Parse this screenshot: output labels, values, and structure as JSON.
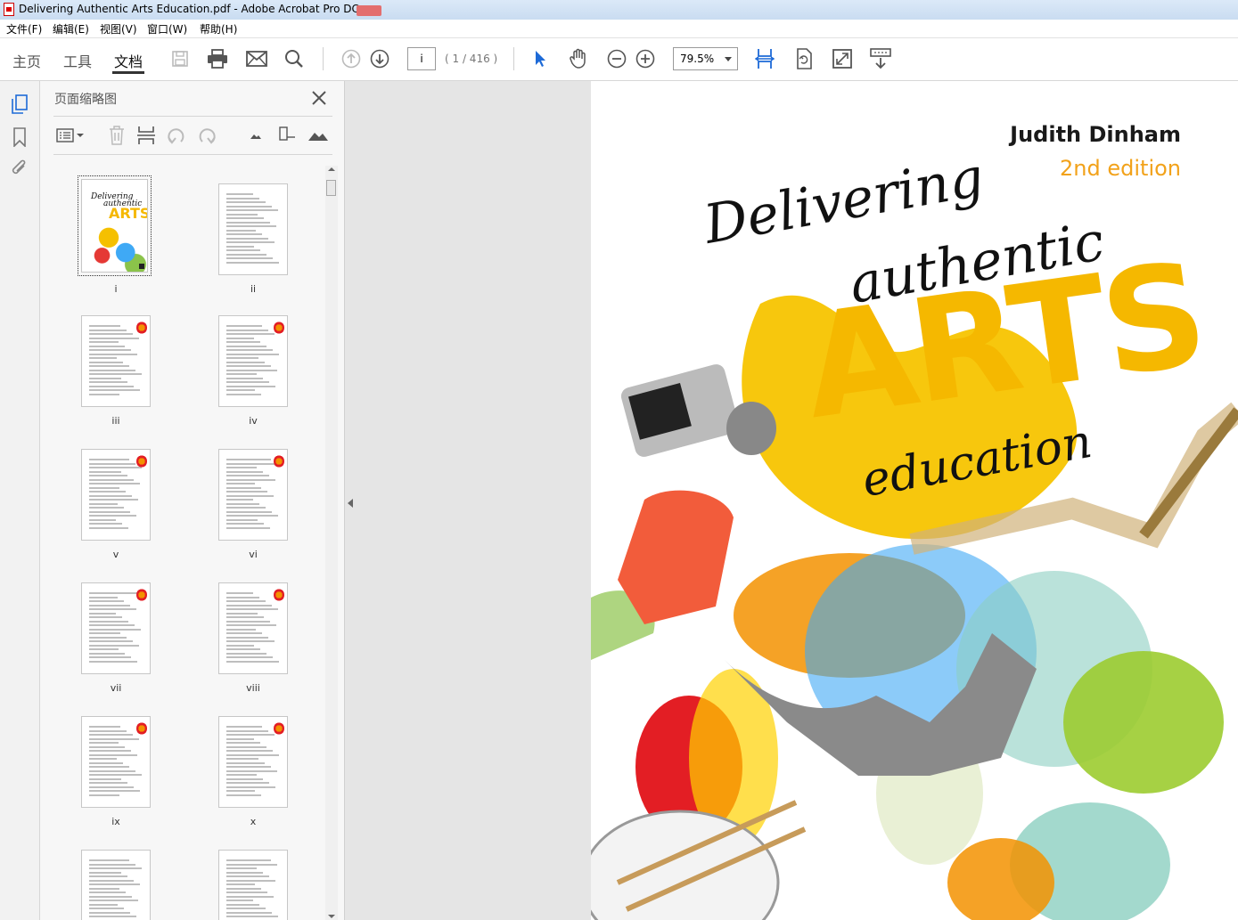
{
  "window": {
    "title": "Delivering Authentic Arts Education.pdf - Adobe Acrobat Pro DC"
  },
  "menu": [
    "文件(F)",
    "编辑(E)",
    "视图(V)",
    "窗口(W)",
    "帮助(H)"
  ],
  "toolbar": {
    "tabs": [
      "主页",
      "工具",
      "文档"
    ],
    "active_tab": "文档",
    "page_input": "i",
    "page_count": "( 1 / 416 )",
    "zoom": "79.5%"
  },
  "sidebar": {
    "panel_title": "页面缩略图",
    "thumbnails": [
      "i",
      "ii",
      "iii",
      "iv",
      "v",
      "vi",
      "vii",
      "viii",
      "ix",
      "x",
      "",
      ""
    ],
    "selected": "i"
  },
  "cover": {
    "author": "Judith Dinham",
    "edition": "2nd edition",
    "title_line1": "Delivering",
    "title_line2": "authentic",
    "title_big": "ARTS",
    "title_line3": "education",
    "accent": "#f5b800",
    "edition_color": "#f2a21a"
  },
  "icons": [
    "save-icon",
    "print-icon",
    "email-icon",
    "search-icon",
    "page-up-icon",
    "page-down-icon",
    "select-cursor-icon",
    "hand-icon",
    "zoom-out-icon",
    "zoom-in-icon",
    "fit-width-icon",
    "rotate-page-icon",
    "full-screen-icon",
    "scroll-mode-icon",
    "pages-panel-icon",
    "bookmark-icon",
    "attachment-icon",
    "close-icon",
    "options-menu-icon",
    "delete-icon",
    "insert-icon",
    "undo-icon",
    "redo-icon",
    "thumb-small-icon",
    "thumb-slider-icon",
    "thumb-large-icon"
  ]
}
